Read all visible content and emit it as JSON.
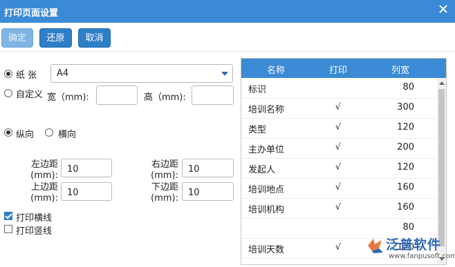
{
  "window": {
    "title": "打印页面设置"
  },
  "toolbar": {
    "confirm_label": "确定",
    "restore_label": "还原",
    "cancel_label": "取消"
  },
  "paper": {
    "paper_label": "纸 张",
    "custom_label": "自定义",
    "paper_value": "A4",
    "width_label": "宽（mm):",
    "height_label": "高（mm):",
    "width_value": "",
    "height_value": ""
  },
  "orientation": {
    "portrait_label": "纵向",
    "landscape_label": "横向",
    "selected": "portrait"
  },
  "margins": {
    "left_label_1": "左边距",
    "left_label_2": "(mm):",
    "left_value": "10",
    "right_label_1": "右边距",
    "right_label_2": "(mm):",
    "right_value": "10",
    "top_label_1": "上边距",
    "top_label_2": "(mm):",
    "top_value": "10",
    "bottom_label_1": "下边距",
    "bottom_label_2": "(mm):",
    "bottom_value": "10"
  },
  "options": {
    "print_horizontal_label": "打印横线",
    "print_horizontal_checked": true,
    "print_vertical_label": "打印竖线",
    "print_vertical_checked": false
  },
  "grid": {
    "headers": [
      "名称",
      "打印",
      "列宽"
    ],
    "rows": [
      [
        "标识",
        "",
        "80"
      ],
      [
        "培训名称",
        "√",
        "300"
      ],
      [
        "类型",
        "√",
        "120"
      ],
      [
        "主办单位",
        "√",
        "200"
      ],
      [
        "发起人",
        "√",
        "120"
      ],
      [
        "培训地点",
        "√",
        "160"
      ],
      [
        "培训机构",
        "√",
        "160"
      ],
      [
        "",
        "",
        "80"
      ],
      [
        "培训天数",
        "√",
        "120"
      ]
    ]
  },
  "watermark": {
    "brand": "泛普软件",
    "url": "www.fanpusoft.com"
  },
  "colors": {
    "title_bar": "#3b8ad5",
    "button": "#2f7fc8",
    "disabled_button": "#7fb4e4"
  }
}
